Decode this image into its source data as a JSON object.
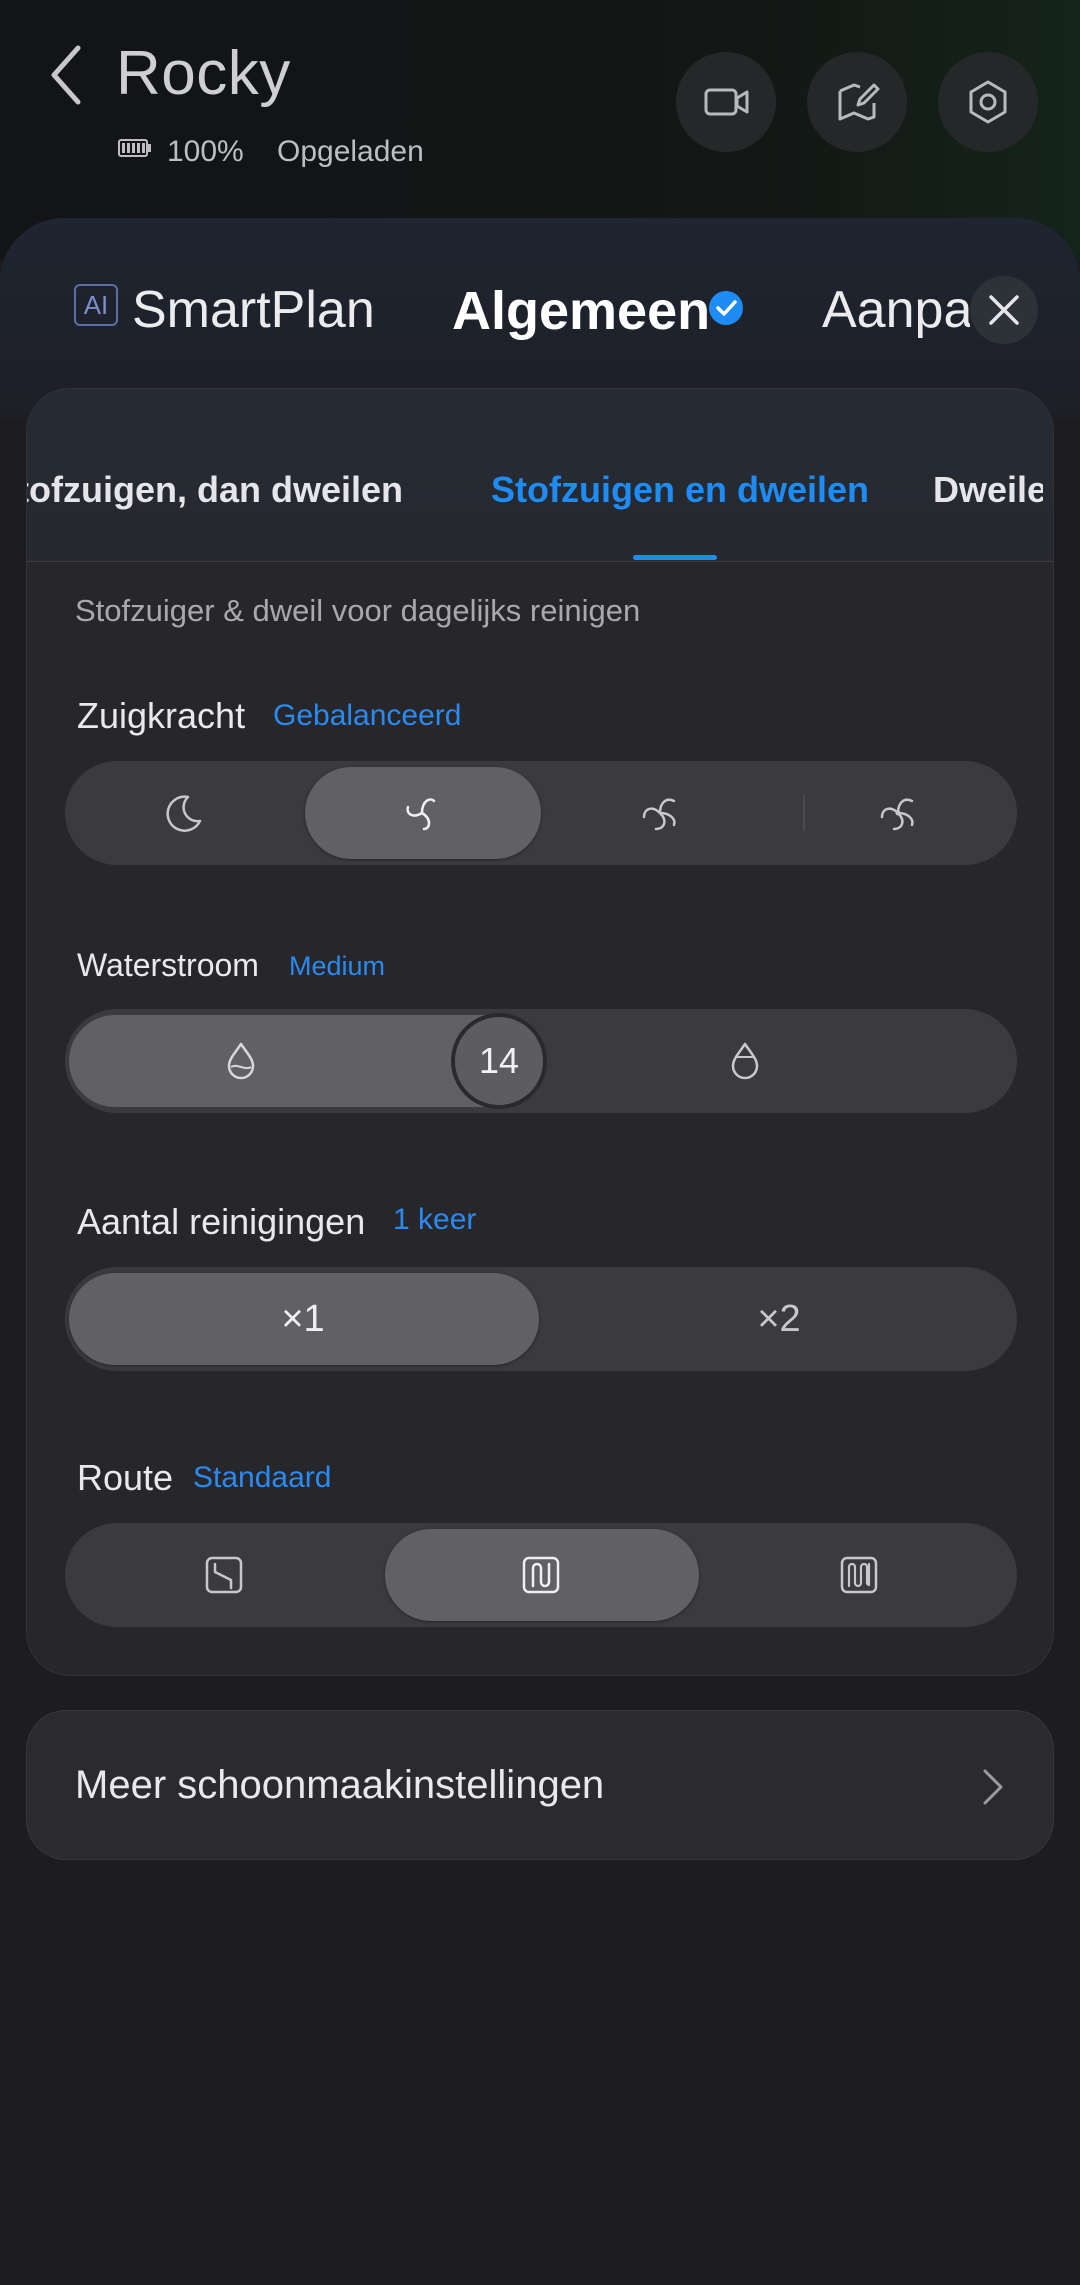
{
  "header": {
    "title": "Rocky",
    "battery_percent": "100%",
    "battery_status": "Opgeladen"
  },
  "tabs": {
    "ai_badge": "AI",
    "smartplan": "SmartPlan",
    "general": "Algemeen",
    "custom": "Aanpassen"
  },
  "modes": {
    "items": [
      "Stofzuigen, dan dweilen",
      "Stofzuigen en dweilen",
      "Dweilen"
    ],
    "selected": 1
  },
  "description": "Stofzuiger & dweil voor dagelijks reinigen",
  "suction": {
    "label": "Zuigkracht",
    "value": "Gebalanceerd",
    "selected_index": 1
  },
  "water": {
    "label": "Waterstroom",
    "value": "Medium",
    "level": "14"
  },
  "passes": {
    "label": "Aantal reinigingen",
    "value": "1 keer",
    "options": [
      "×1",
      "×2"
    ],
    "selected_index": 0
  },
  "route": {
    "label": "Route",
    "value": "Standaard",
    "selected_index": 1
  },
  "more_settings": "Meer schoonmaakinstellingen",
  "colors": {
    "accent": "#1f8cf5",
    "background": "#1c1c1f",
    "card": "#27272b"
  },
  "icons": [
    "back-arrow-icon",
    "battery-icon",
    "video-icon",
    "map-edit-icon",
    "settings-icon",
    "check-badge-icon",
    "close-icon",
    "moon-icon",
    "fan-icon",
    "drop-icon",
    "route-icon",
    "chevron-right-icon"
  ]
}
